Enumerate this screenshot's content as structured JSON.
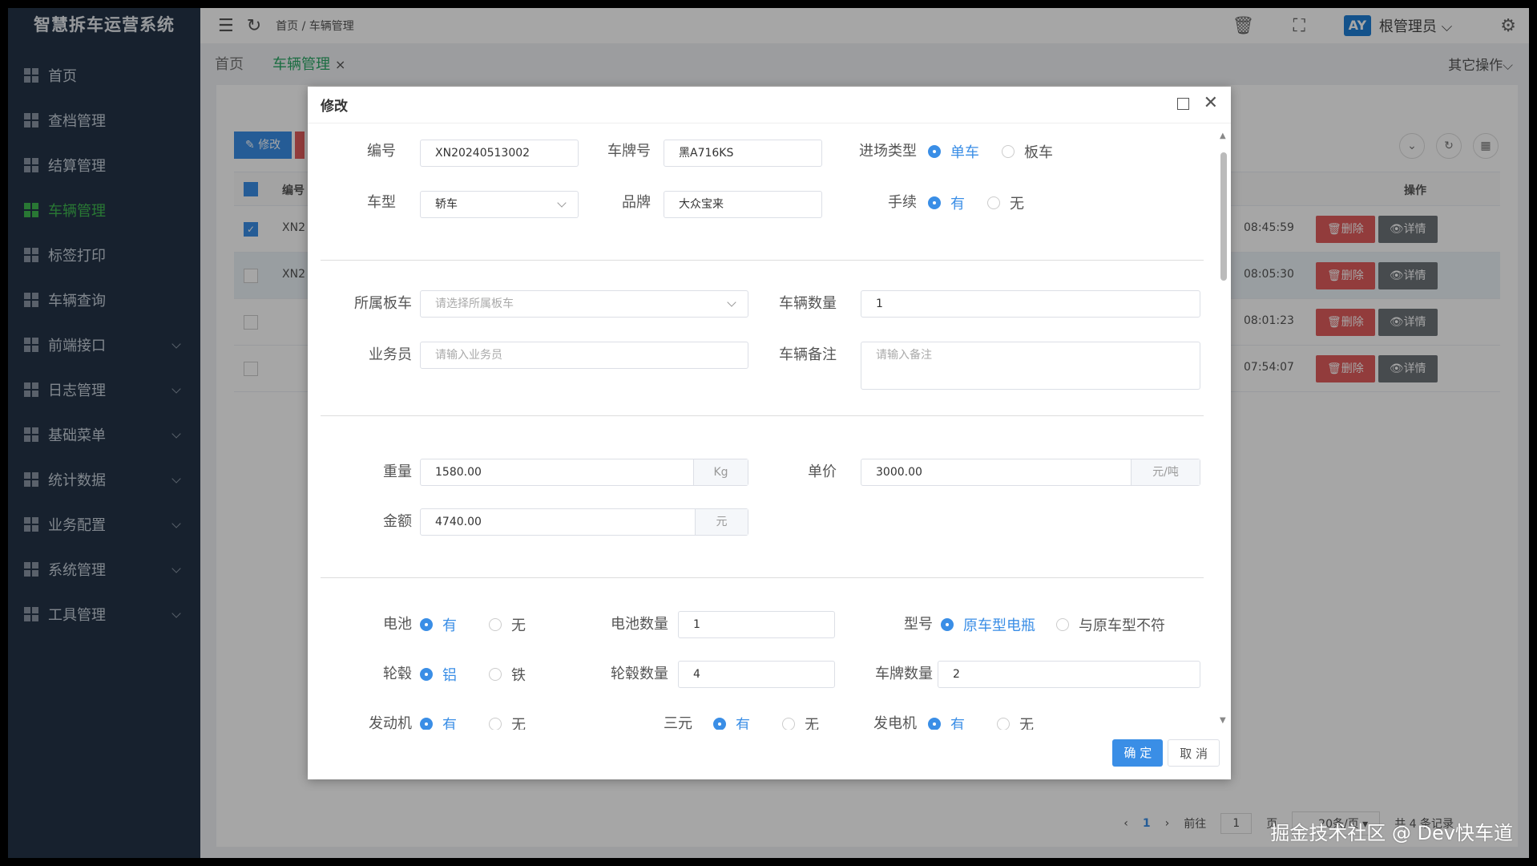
{
  "app": {
    "title": "智慧拆车运营系统"
  },
  "sidebar": {
    "items": [
      {
        "label": "首页",
        "sub": false
      },
      {
        "label": "查档管理",
        "sub": false
      },
      {
        "label": "结算管理",
        "sub": false
      },
      {
        "label": "车辆管理",
        "sub": false,
        "active": true
      },
      {
        "label": "标签打印",
        "sub": false
      },
      {
        "label": "车辆查询",
        "sub": false
      },
      {
        "label": "前端接口",
        "sub": true
      },
      {
        "label": "日志管理",
        "sub": true
      },
      {
        "label": "基础菜单",
        "sub": true
      },
      {
        "label": "统计数据",
        "sub": true
      },
      {
        "label": "业务配置",
        "sub": true
      },
      {
        "label": "系统管理",
        "sub": true
      },
      {
        "label": "工具管理",
        "sub": true
      }
    ]
  },
  "header": {
    "breadcrumb_home": "首页",
    "breadcrumb_sep": "/",
    "breadcrumb_current": "车辆管理",
    "avatar": "AY",
    "user": "根管理员"
  },
  "tabs": {
    "home": "首页",
    "current": "车辆管理",
    "close": "×",
    "other": "其它操作"
  },
  "toolbar": {
    "edit": "修改"
  },
  "table": {
    "col_code": "编号",
    "col_ops": "操作",
    "rows": [
      {
        "code": "XN2",
        "time": "08:45:59",
        "checked": true
      },
      {
        "code": "XN2",
        "time": "08:05:30",
        "checked": false
      },
      {
        "code": "",
        "time": "08:01:23",
        "checked": false
      },
      {
        "code": "",
        "time": "07:54:07",
        "checked": false
      }
    ],
    "del": "删除",
    "detail": "详情"
  },
  "pager": {
    "page": "1",
    "goto": "前往",
    "goto_page": "1",
    "unit": "页",
    "size": "20条/页",
    "total": "共 4 条记录"
  },
  "modal": {
    "title": "修改",
    "labels": {
      "code": "编号",
      "plate": "车牌号",
      "entry_type": "进场类型",
      "vtype": "车型",
      "brand": "品牌",
      "formalities": "手续",
      "trailer": "所属板车",
      "vcount": "车辆数量",
      "salesman": "业务员",
      "remark": "车辆备注",
      "weight": "重量",
      "price": "单价",
      "amount": "金额",
      "battery": "电池",
      "battery_qty": "电池数量",
      "model": "型号",
      "wheel": "轮毂",
      "wheel_qty": "轮毂数量",
      "plate_qty": "车牌数量",
      "engine": "发动机",
      "catalyst": "三元",
      "generator": "发电机"
    },
    "values": {
      "code": "XN20240513002",
      "plate": "黑A716KS",
      "vtype": "轿车",
      "brand": "大众宝来",
      "vcount": "1",
      "weight": "1580.00",
      "price": "3000.00",
      "amount": "4740.00",
      "battery_qty": "1",
      "wheel_qty": "4",
      "plate_qty": "2"
    },
    "placeholders": {
      "trailer": "请选择所属板车",
      "salesman": "请输入业务员",
      "remark": "请输入备注"
    },
    "units": {
      "weight": "Kg",
      "price": "元/吨",
      "amount": "元"
    },
    "options": {
      "single": "单车",
      "board": "板车",
      "yes": "有",
      "no": "无",
      "original": "原车型电瓶",
      "mismatch": "与原车型不符",
      "alu": "铝",
      "iron": "铁"
    },
    "ok": "确 定",
    "cancel": "取 消"
  },
  "watermark": "掘金技术社区 @ Dev快车道"
}
